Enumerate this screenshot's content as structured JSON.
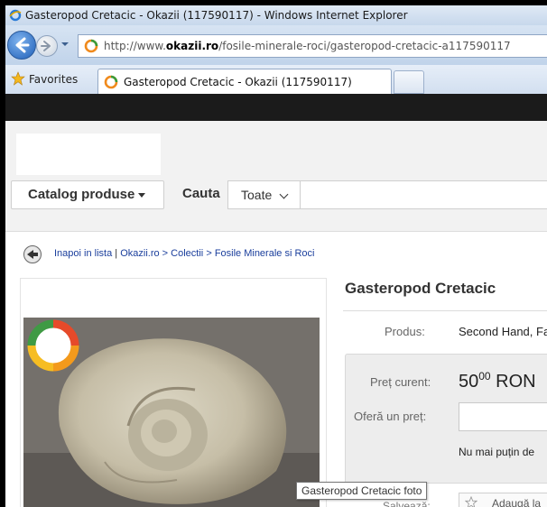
{
  "window": {
    "title": "Gasteropod Cretacic - Okazii (117590117) - Windows Internet Explorer"
  },
  "address": {
    "url_prefix": "http://www.",
    "url_domain": "okazii.ro",
    "url_path": "/fosile-minerale-roci/gasteropod-cretacic-a117590117"
  },
  "favorites_bar": {
    "favorites_label": "Favorites",
    "tab_label": "Gasteropod Cretacic - Okazii (117590117)"
  },
  "header": {
    "catalog_label": "Catalog produse",
    "search_label": "Cauta",
    "category_select": "Toate",
    "search_value": ""
  },
  "breadcrumb": {
    "back": "Inapoi in lista",
    "sep": "|",
    "site": "Okazii.ro",
    "arrow": ">",
    "colectii": "Colectii",
    "category": "Fosile Minerale si Roci"
  },
  "product": {
    "title": "Gasteropod Cretacic",
    "produs_label": "Produs:",
    "produs_value": "Second Hand, Fa",
    "pret_label": "Preț curent:",
    "price_int": "50",
    "price_dec": "00",
    "currency": "RON",
    "oferta_label": "Oferă un preț:",
    "oferta_value": "",
    "numai_text": "Nu mai puțin de ",
    "salveaza_label": "Salvează:",
    "adauga_label": "Adaugă la"
  },
  "tooltip": {
    "text": "Gasteropod Cretacic foto"
  },
  "colors": {
    "dark_bar": "#1b1b1b",
    "header_bg": "#f2f2f2",
    "link": "#1a3e9c",
    "price_box": "#ededed"
  }
}
